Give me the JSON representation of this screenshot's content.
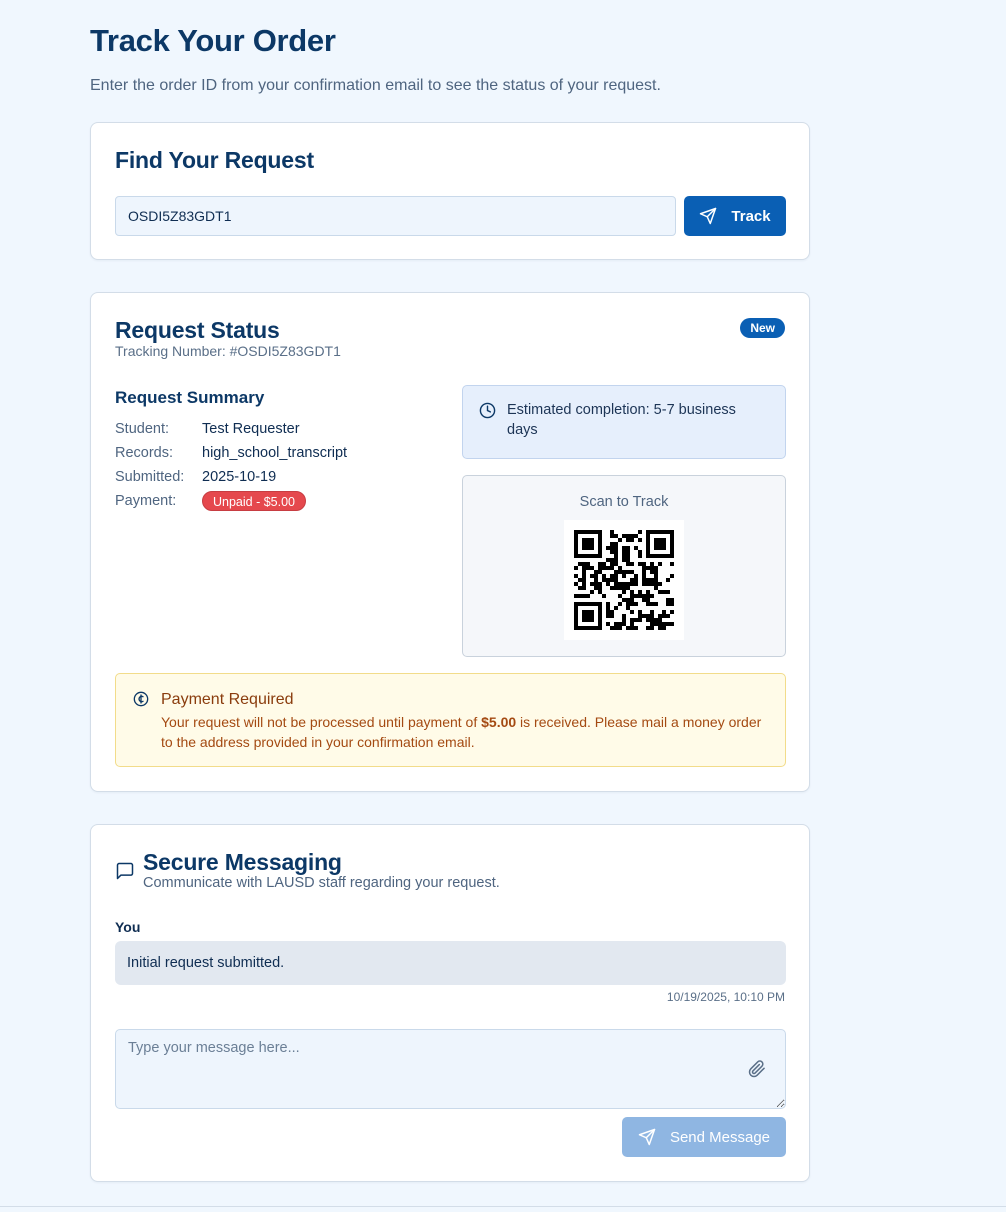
{
  "header": {
    "title": "Track Your Order",
    "subtitle": "Enter the order ID from your confirmation email to see the status of your request."
  },
  "find": {
    "title": "Find Your Request",
    "order_id": "OSDI5Z83GDT1",
    "track_label": "Track"
  },
  "status": {
    "title": "Request Status",
    "tracking_number": "Tracking Number: #OSDI5Z83GDT1",
    "badge": "New",
    "summary_title": "Request Summary",
    "rows": [
      {
        "label": "Student:",
        "value": "Test Requester"
      },
      {
        "label": "Records:",
        "value": "high_school_transcript"
      },
      {
        "label": "Submitted:",
        "value": "2025-10-19"
      },
      {
        "label": "Payment:",
        "value": "Unpaid - $5.00"
      }
    ],
    "estimate": "Estimated completion: 5-7 business days",
    "qr_label": "Scan to Track",
    "payment_alert": {
      "title": "Payment Required",
      "body_before": "Your request will not be processed until payment of ",
      "amount": "$5.00",
      "body_after": " is received. Please mail a money order to the address provided in your confirmation email."
    }
  },
  "messaging": {
    "title": "Secure Messaging",
    "subtitle": "Communicate with LAUSD staff regarding your request.",
    "messages": [
      {
        "author": "You",
        "text": "Initial request submitted.",
        "time": "10/19/2025, 10:10 PM"
      }
    ],
    "input_placeholder": "Type your message here...",
    "send_label": "Send Message"
  },
  "colors": {
    "primary": "#0a5fb4",
    "heading": "#0c3866",
    "danger": "#e5484d",
    "warning_bg": "#fffbe8",
    "warning_text": "#a44a12",
    "send_disabled": "#8fb6e2"
  },
  "icons": {
    "track_button": "send-icon",
    "estimate": "clock-icon",
    "payment_alert": "currency-circle-icon",
    "messaging": "message-square-icon",
    "attach": "paperclip-icon",
    "send_button": "send-icon"
  }
}
